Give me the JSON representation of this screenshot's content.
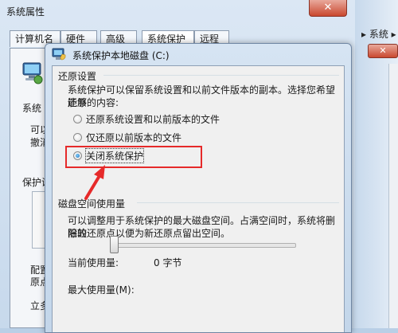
{
  "back_window": {
    "title": "系统属性",
    "close_glyph": "✕",
    "tabs": [
      "计算机名",
      "硬件",
      "高级",
      "系统保护",
      "远程"
    ],
    "partial_texts": [
      "系统",
      "可以",
      "撤消",
      "保护设",
      "配置",
      "原点",
      "立多"
    ]
  },
  "right_strip": {
    "nav_text": "▸ 系统 ▸",
    "close_glyph": "✕"
  },
  "dialog": {
    "title": "系统保护本地磁盘 (C:)",
    "restore_group": {
      "label": "还原设置",
      "description_line1": "系统保护可以保留系统设置和以前文件版本的副本。选择您希望能够",
      "description_line2": "还原的内容:",
      "options": [
        {
          "label": "还原系统设置和以前版本的文件",
          "selected": false
        },
        {
          "label": "仅还原以前版本的文件",
          "selected": false
        },
        {
          "label": "关闭系统保护",
          "selected": true
        }
      ]
    },
    "disk_group": {
      "label": "磁盘空间使用量",
      "description_line1": "可以调整用于系统保护的最大磁盘空间。占满空间时，系统将删除较",
      "description_line2": "旧的还原点以便为新还原点留出空间。",
      "current_usage_label": "当前使用量:",
      "current_usage_value": "0 字节",
      "max_usage_label": "最大使用量(M):",
      "max_usage_fraction": 0.0
    }
  },
  "colors": {
    "annotation_red": "#e62a2a",
    "radio_selected": "#1f6bb5"
  }
}
